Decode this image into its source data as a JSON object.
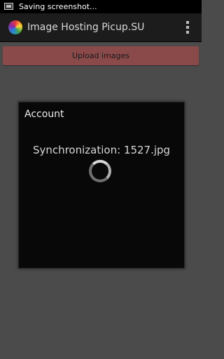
{
  "status_bar": {
    "text": "Saving screenshot..."
  },
  "action_bar": {
    "title": "Image Hosting Picup.SU"
  },
  "main": {
    "upload_button_label": "Upload images"
  },
  "dialog": {
    "title": "Account",
    "message": "Synchronization: 1527.jpg"
  },
  "colors": {
    "background": "#4b4b4b",
    "action_bar": "#1c1c1c",
    "upload_button": "#8a4a4a",
    "dialog_background": "#080808"
  },
  "icons": [
    "screenshot-icon",
    "app-icon",
    "overflow-menu-icon",
    "loading-spinner"
  ]
}
